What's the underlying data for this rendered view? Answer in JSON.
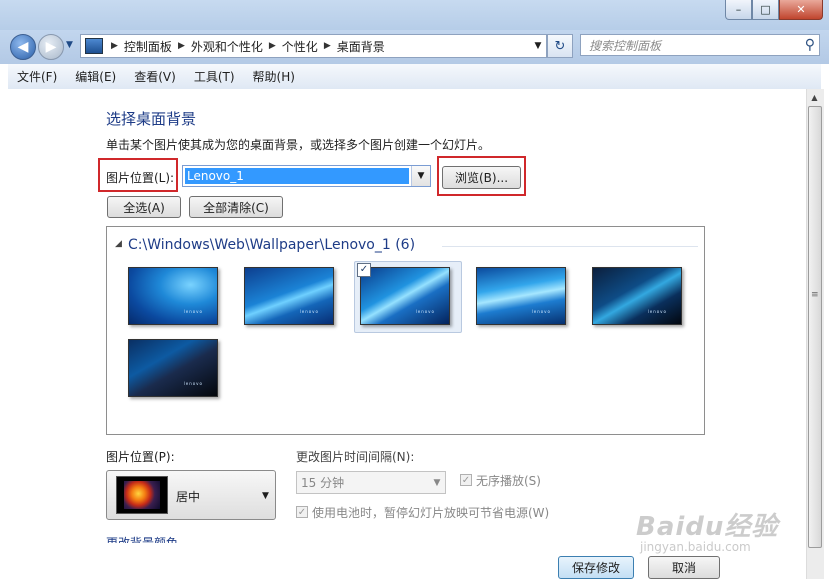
{
  "window": {
    "min_label": "–",
    "max_label": "□",
    "close_label": "✕"
  },
  "nav": {
    "breadcrumbs": [
      "控制面板",
      "外观和个性化",
      "个性化",
      "桌面背景"
    ],
    "search_placeholder": "搜索控制面板"
  },
  "menu": [
    "文件(F)",
    "编辑(E)",
    "查看(V)",
    "工具(T)",
    "帮助(H)"
  ],
  "main": {
    "title": "选择桌面背景",
    "description": "单击某个图片使其成为您的桌面背景，或选择多个图片创建一个幻灯片。",
    "location_label": "图片位置(L):",
    "location_value": "Lenovo_1",
    "browse_label": "浏览(B)...",
    "select_all_label": "全选(A)",
    "clear_all_label": "全部清除(C)",
    "group_title": "C:\\Windows\\Web\\Wallpaper\\Lenovo_1 (6)",
    "wallpaper_logo_text": "lenovo",
    "selected_index": 2,
    "selected_checkmark": "✓"
  },
  "options": {
    "position_label": "图片位置(P):",
    "position_value": "居中",
    "interval_label": "更改图片时间间隔(N):",
    "interval_value": "15 分钟",
    "shuffle_label": "无序播放(S)",
    "battery_label": "使用电池时，暂停幻灯片放映可节省电源(W)",
    "color_link_partial": "更改背景颜色"
  },
  "buttons": {
    "save": "保存修改",
    "cancel": "取消"
  },
  "watermark": {
    "brand": "Baidu经验",
    "url": "jingyan.baidu.com"
  }
}
